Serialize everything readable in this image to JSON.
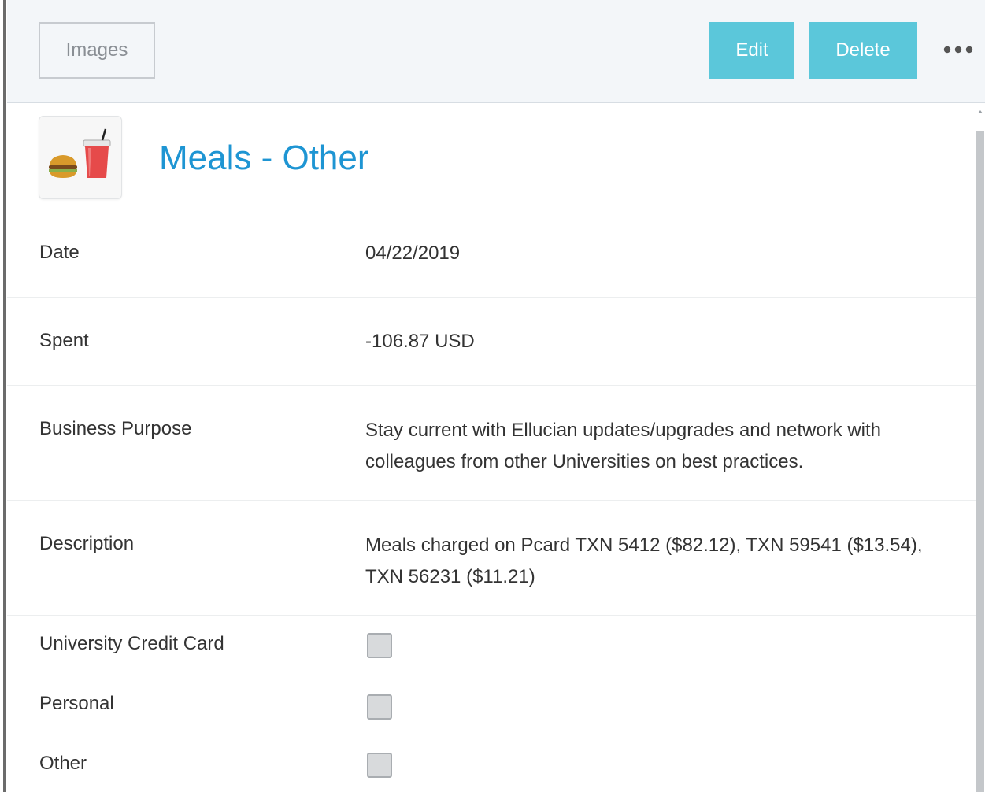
{
  "toolbar": {
    "images_label": "Images",
    "edit_label": "Edit",
    "delete_label": "Delete",
    "more_icon": "more-horizontal-icon"
  },
  "header": {
    "category_icon": "meals-icon",
    "title": "Meals - Other"
  },
  "fields": [
    {
      "label": "Date",
      "value": "04/22/2019"
    },
    {
      "label": "Spent",
      "value": "-106.87 USD"
    },
    {
      "label": "Business Purpose",
      "value": "Stay current with Ellucian updates/upgrades and network with colleagues from other Universities on best practices."
    },
    {
      "label": "Description",
      "value": "Meals charged on Pcard TXN 5412 ($82.12), TXN 59541 ($13.54), TXN 56231 ($11.21)"
    }
  ],
  "checkboxes": [
    {
      "label": "University Credit Card",
      "checked": false
    },
    {
      "label": "Personal",
      "checked": false
    },
    {
      "label": "Other",
      "checked": false
    }
  ],
  "colors": {
    "accent": "#5bc7da",
    "title": "#1e95d3",
    "toolbar_bg": "#f3f6f9"
  }
}
